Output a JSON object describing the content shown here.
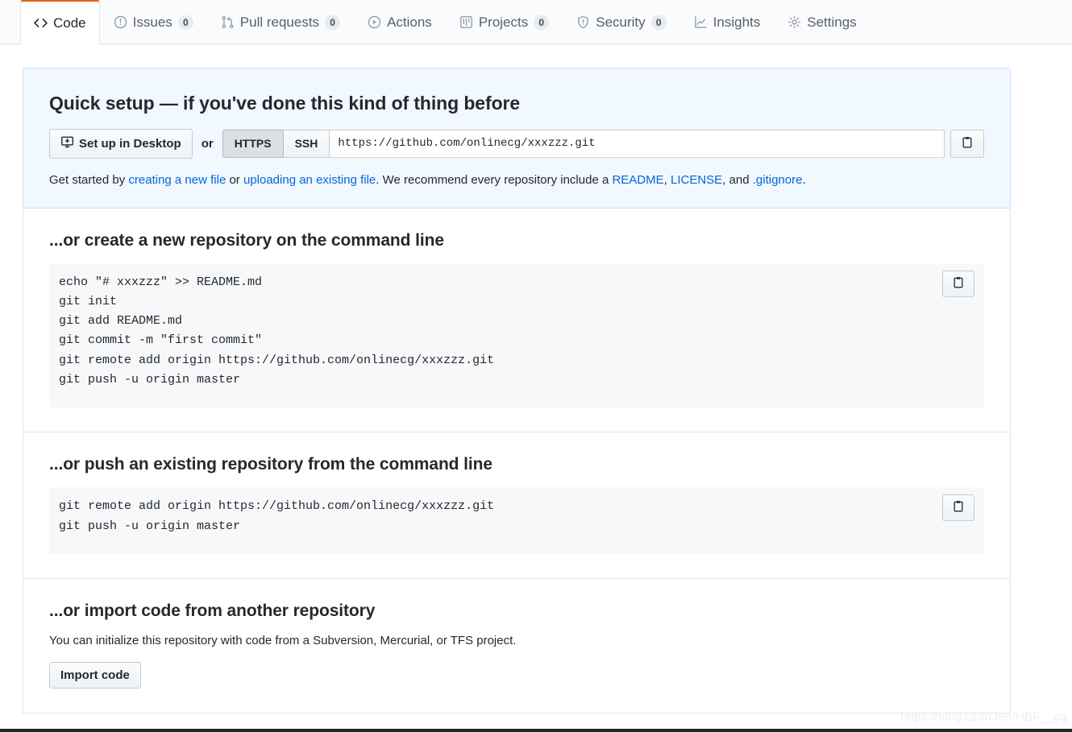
{
  "repo_nav": {
    "tabs": [
      {
        "label": "Code",
        "icon": "code-icon",
        "count": null,
        "active": true
      },
      {
        "label": "Issues",
        "icon": "issue-opened-icon",
        "count": "0",
        "active": false
      },
      {
        "label": "Pull requests",
        "icon": "git-pull-request-icon",
        "count": "0",
        "active": false
      },
      {
        "label": "Actions",
        "icon": "play-icon",
        "count": null,
        "active": false
      },
      {
        "label": "Projects",
        "icon": "project-board-icon",
        "count": "0",
        "active": false
      },
      {
        "label": "Security",
        "icon": "shield-icon",
        "count": "0",
        "active": false
      },
      {
        "label": "Insights",
        "icon": "graph-icon",
        "count": null,
        "active": false
      },
      {
        "label": "Settings",
        "icon": "gear-icon",
        "count": null,
        "active": false
      }
    ]
  },
  "quick_setup": {
    "title": "Quick setup — if you've done this kind of thing before",
    "desktop_button": "Set up in Desktop",
    "or_label": "or",
    "protocol_https": "HTTPS",
    "protocol_ssh": "SSH",
    "selected_protocol": "HTTPS",
    "clone_url": "https://github.com/onlinecg/xxxzzz.git",
    "copy_icon": "clipboard-icon",
    "hint": {
      "part1": "Get started by ",
      "link1": "creating a new file",
      "part2": " or ",
      "link2": "uploading an existing file",
      "part3": ". We recommend every repository include a ",
      "link3": "README",
      "part4": ", ",
      "link4": "LICENSE",
      "part5": ", and ",
      "link5": ".gitignore",
      "part6": "."
    }
  },
  "create_repo_section": {
    "heading": "...or create a new repository on the command line",
    "copy_icon": "clipboard-icon",
    "commands": [
      "echo \"# xxxzzz\" >> README.md",
      "git init",
      "git add README.md",
      "git commit -m \"first commit\"",
      "git remote add origin https://github.com/onlinecg/xxxzzz.git",
      "git push -u origin master"
    ]
  },
  "push_repo_section": {
    "heading": "...or push an existing repository from the command line",
    "copy_icon": "clipboard-icon",
    "commands": [
      "git remote add origin https://github.com/onlinecg/xxxzzz.git",
      "git push -u origin master"
    ]
  },
  "import_section": {
    "heading": "...or import code from another repository",
    "description": "You can initialize this repository with code from a Subversion, Mercurial, or TFS project.",
    "button": "Import code"
  },
  "watermark": "https://blog.csdn.net/HBF__cg",
  "colors": {
    "active_tab_accent": "#e36209",
    "link": "#0366d6",
    "quick_setup_bg": "#f1f8ff",
    "quick_setup_border": "#c8e1ff",
    "code_bg": "#f6f8fa",
    "border": "#e1e4e8"
  }
}
